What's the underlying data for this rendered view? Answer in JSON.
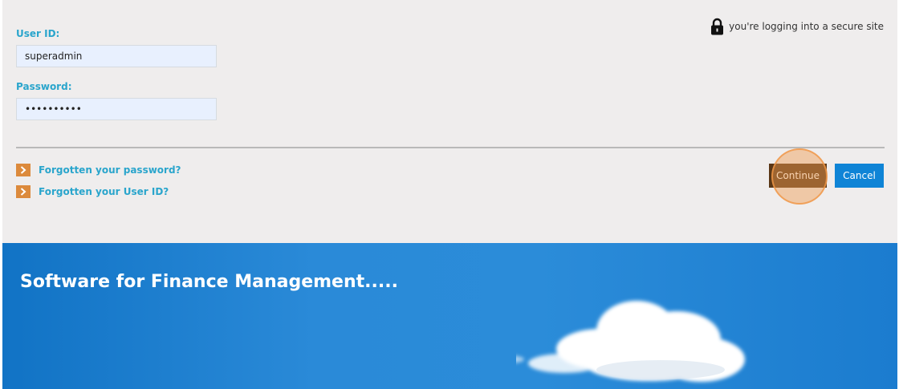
{
  "login": {
    "user_id_label": "User ID:",
    "user_id_value": "superadmin",
    "password_label": "Password:",
    "password_value": "••••••••••"
  },
  "secure_notice": {
    "text": "you're logging into a secure site",
    "icon": "lock-icon"
  },
  "links": {
    "forgot_password": "Forgotten your password?",
    "forgot_user_id": "Forgotten your User ID?",
    "arrow_icon": "chevron-right-icon",
    "arrow_color": "#dc8a3c"
  },
  "buttons": {
    "continue_label": "Continue",
    "cancel_label": "Cancel",
    "continue_color": "#5a3716",
    "cancel_color": "#0f84d6"
  },
  "banner": {
    "title": "Software for Finance Management.....",
    "color": "#2b8cd9"
  },
  "colors": {
    "accent_text": "#2aa5cc",
    "background": "#efeded"
  }
}
